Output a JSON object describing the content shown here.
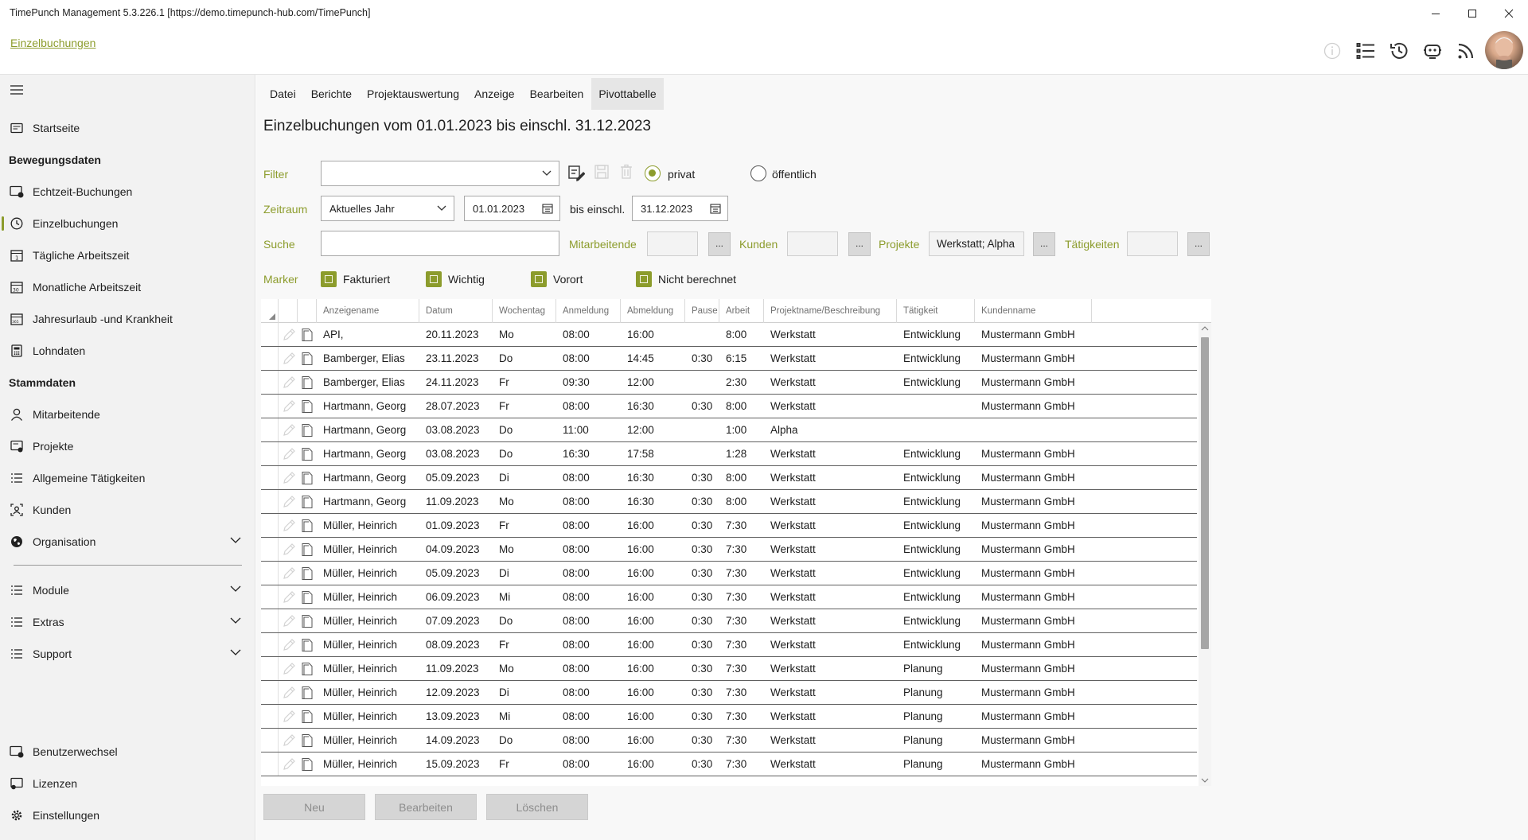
{
  "window": {
    "title": "TimePunch Management 5.3.226.1 [https://demo.timepunch-hub.com/TimePunch]"
  },
  "header": {
    "breadcrumb": "Einzelbuchungen",
    "icons": [
      "info-icon",
      "list-icon",
      "history-icon",
      "robot-icon",
      "rss-icon"
    ]
  },
  "sidebar": {
    "items": [
      {
        "label": "Startseite",
        "icon": "home-icon"
      },
      {
        "label": "Echtzeit-Buchungen",
        "icon": "realtime-icon"
      },
      {
        "label": "Einzelbuchungen",
        "icon": "clock-icon"
      },
      {
        "label": "Tägliche Arbeitszeit",
        "icon": "calendar-day-icon"
      },
      {
        "label": "Monatliche Arbeitszeit",
        "icon": "calendar-month-icon"
      },
      {
        "label": "Jahresurlaub -und Krankheit",
        "icon": "calendar-year-icon"
      },
      {
        "label": "Lohndaten",
        "icon": "calculator-icon"
      },
      {
        "label": "Mitarbeitende",
        "icon": "person-icon"
      },
      {
        "label": "Projekte",
        "icon": "project-icon"
      },
      {
        "label": "Allgemeine Tätigkeiten",
        "icon": "list-icon"
      },
      {
        "label": "Kunden",
        "icon": "customer-icon"
      },
      {
        "label": "Organisation",
        "icon": "globe-icon"
      },
      {
        "label": "Module",
        "icon": "list-icon"
      },
      {
        "label": "Extras",
        "icon": "list-icon"
      },
      {
        "label": "Support",
        "icon": "list-icon"
      },
      {
        "label": "Benutzerwechsel",
        "icon": "switch-user-icon"
      },
      {
        "label": "Lizenzen",
        "icon": "license-icon"
      },
      {
        "label": "Einstellungen",
        "icon": "gear-icon"
      }
    ],
    "heading_bewegungsdaten": "Bewegungsdaten",
    "heading_stammdaten": "Stammdaten"
  },
  "menu": {
    "items": [
      "Datei",
      "Berichte",
      "Projektauswertung",
      "Anzeige",
      "Bearbeiten",
      "Pivottabelle"
    ],
    "active": "Pivottabelle"
  },
  "page": {
    "title": "Einzelbuchungen vom 01.01.2023 bis einschl. 31.12.2023"
  },
  "filter": {
    "filter_label": "Filter",
    "filter_value": "",
    "privat_label": "privat",
    "oeffentlich_label": "öffentlich",
    "zeitraum_label": "Zeitraum",
    "zeitraum_value": "Aktuelles Jahr",
    "from_date": "01.01.2023",
    "bis_label": "bis einschl.",
    "to_date": "31.12.2023",
    "suche_label": "Suche",
    "suche_value": "",
    "mitarbeitende_label": "Mitarbeitende",
    "kunden_label": "Kunden",
    "projekte_label": "Projekte",
    "projekte_value": "Werkstatt; Alpha",
    "taetigkeiten_label": "Tätigkeiten",
    "dots": "...",
    "marker_label": "Marker",
    "markers": [
      "Fakturiert",
      "Wichtig",
      "Vorort",
      "Nicht berechnet"
    ]
  },
  "table": {
    "columns": [
      "Anzeigename",
      "Datum",
      "Wochentag",
      "Anmeldung",
      "Abmeldung",
      "Pause",
      "Arbeit",
      "Projektname/Beschreibung",
      "Tätigkeit",
      "Kundenname"
    ],
    "rows": [
      [
        "API,",
        "20.11.2023",
        "Mo",
        "08:00",
        "16:00",
        "",
        "8:00",
        "Werkstatt",
        "Entwicklung",
        "Mustermann GmbH"
      ],
      [
        "Bamberger, Elias",
        "23.11.2023",
        "Do",
        "08:00",
        "14:45",
        "0:30",
        "6:15",
        "Werkstatt",
        "Entwicklung",
        "Mustermann GmbH"
      ],
      [
        "Bamberger, Elias",
        "24.11.2023",
        "Fr",
        "09:30",
        "12:00",
        "",
        "2:30",
        "Werkstatt",
        "Entwicklung",
        "Mustermann GmbH"
      ],
      [
        "Hartmann, Georg",
        "28.07.2023",
        "Fr",
        "08:00",
        "16:30",
        "0:30",
        "8:00",
        "Werkstatt",
        "",
        "Mustermann GmbH"
      ],
      [
        "Hartmann, Georg",
        "03.08.2023",
        "Do",
        "11:00",
        "12:00",
        "",
        "1:00",
        "Alpha",
        "",
        ""
      ],
      [
        "Hartmann, Georg",
        "03.08.2023",
        "Do",
        "16:30",
        "17:58",
        "",
        "1:28",
        "Werkstatt",
        "Entwicklung",
        "Mustermann GmbH"
      ],
      [
        "Hartmann, Georg",
        "05.09.2023",
        "Di",
        "08:00",
        "16:30",
        "0:30",
        "8:00",
        "Werkstatt",
        "Entwicklung",
        "Mustermann GmbH"
      ],
      [
        "Hartmann, Georg",
        "11.09.2023",
        "Mo",
        "08:00",
        "16:30",
        "0:30",
        "8:00",
        "Werkstatt",
        "Entwicklung",
        "Mustermann GmbH"
      ],
      [
        "Müller, Heinrich",
        "01.09.2023",
        "Fr",
        "08:00",
        "16:00",
        "0:30",
        "7:30",
        "Werkstatt",
        "Entwicklung",
        "Mustermann GmbH"
      ],
      [
        "Müller, Heinrich",
        "04.09.2023",
        "Mo",
        "08:00",
        "16:00",
        "0:30",
        "7:30",
        "Werkstatt",
        "Entwicklung",
        "Mustermann GmbH"
      ],
      [
        "Müller, Heinrich",
        "05.09.2023",
        "Di",
        "08:00",
        "16:00",
        "0:30",
        "7:30",
        "Werkstatt",
        "Entwicklung",
        "Mustermann GmbH"
      ],
      [
        "Müller, Heinrich",
        "06.09.2023",
        "Mi",
        "08:00",
        "16:00",
        "0:30",
        "7:30",
        "Werkstatt",
        "Entwicklung",
        "Mustermann GmbH"
      ],
      [
        "Müller, Heinrich",
        "07.09.2023",
        "Do",
        "08:00",
        "16:00",
        "0:30",
        "7:30",
        "Werkstatt",
        "Entwicklung",
        "Mustermann GmbH"
      ],
      [
        "Müller, Heinrich",
        "08.09.2023",
        "Fr",
        "08:00",
        "16:00",
        "0:30",
        "7:30",
        "Werkstatt",
        "Entwicklung",
        "Mustermann GmbH"
      ],
      [
        "Müller, Heinrich",
        "11.09.2023",
        "Mo",
        "08:00",
        "16:00",
        "0:30",
        "7:30",
        "Werkstatt",
        "Planung",
        "Mustermann GmbH"
      ],
      [
        "Müller, Heinrich",
        "12.09.2023",
        "Di",
        "08:00",
        "16:00",
        "0:30",
        "7:30",
        "Werkstatt",
        "Planung",
        "Mustermann GmbH"
      ],
      [
        "Müller, Heinrich",
        "13.09.2023",
        "Mi",
        "08:00",
        "16:00",
        "0:30",
        "7:30",
        "Werkstatt",
        "Planung",
        "Mustermann GmbH"
      ],
      [
        "Müller, Heinrich",
        "14.09.2023",
        "Do",
        "08:00",
        "16:00",
        "0:30",
        "7:30",
        "Werkstatt",
        "Planung",
        "Mustermann GmbH"
      ],
      [
        "Müller, Heinrich",
        "15.09.2023",
        "Fr",
        "08:00",
        "16:00",
        "0:30",
        "7:30",
        "Werkstatt",
        "Planung",
        "Mustermann GmbH"
      ]
    ]
  },
  "buttons": {
    "neu": "Neu",
    "bearbeiten": "Bearbeiten",
    "loeschen": "Löschen"
  },
  "colors": {
    "accent": "#8c9c2c",
    "sidebar_bg": "#f2f2f2",
    "main_bg": "#f8f8f8"
  }
}
